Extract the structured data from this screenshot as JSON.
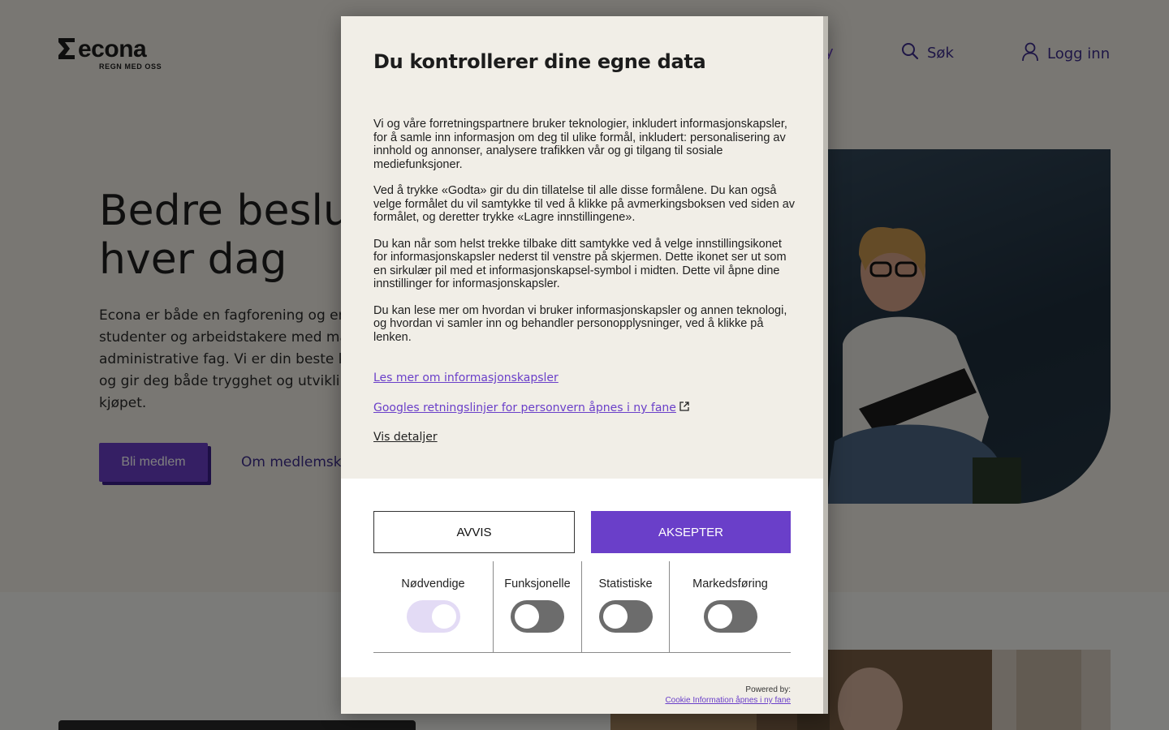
{
  "brand": {
    "name": "econa",
    "tagline": "REGN MED OSS"
  },
  "nav": {
    "partial_item": "y",
    "search_label": "Søk",
    "login_label": "Logg inn"
  },
  "hero": {
    "title_line1": "Bedre beslutninger",
    "title_line2": "hver dag",
    "text_lines": [
      "Econa er både en fagforening og en fagorganisasjon for",
      "studenter og arbeidstakere med mastergrad i økonomiske og",
      "administrative fag. Vi er din beste kollega gjennom karrieren,",
      "og gir deg både trygghet og utvikling – og fordeler på",
      "kjøpet."
    ],
    "primary_button": "Bli medlem",
    "secondary_link": "Om medlemskap"
  },
  "cookie_dialog": {
    "title": "Du kontrollerer dine egne data",
    "paragraphs": [
      "Vi og våre forretningspartnere bruker teknologier, inkludert informasjonskapsler, for å samle inn informasjon om deg til ulike formål, inkludert: personalisering av innhold og annonser, analysere trafikken vår og gi tilgang til sosiale mediefunksjoner.",
      "Ved å trykke «Godta» gir du din tillatelse til alle disse formålene. Du kan også velge formålet du vil samtykke til ved å klikke på avmerkingsboksen ved siden av formålet, og deretter trykke «Lagre innstillingene».",
      "Du kan når som helst trekke tilbake ditt samtykke ved å velge innstillingsikonet for informasjonskapsler nederst til venstre på skjermen. Dette ikonet ser ut som en sirkulær pil med et informasjonskapsel-symbol i midten. Dette vil åpne dine innstillinger for informasjonskapsler.",
      "Du kan lese mer om hvordan vi bruker informasjonskapsler og annen teknologi, og hvordan vi samler inn og behandler personopplysninger, ved å klikke på lenken."
    ],
    "link_cookies": "Les mer om informasjonskapsler",
    "link_google": "Googles retningslinjer for personvern åpnes i ny fane",
    "link_details": "Vis detaljer",
    "reject_label": "AVVIS",
    "accept_label": "AKSEPTER",
    "toggles": [
      {
        "label": "Nødvendige",
        "state": "on"
      },
      {
        "label": "Funksjonelle",
        "state": "off"
      },
      {
        "label": "Statistiske",
        "state": "off"
      },
      {
        "label": "Markedsføring",
        "state": "off"
      }
    ],
    "powered_by": "Powered by:",
    "powered_link": "Cookie Information åpnes i ny fane"
  },
  "colors": {
    "accent": "#6a3fc9",
    "hero_bg": "#f2efe6",
    "dialog_bg": "#f1eee7",
    "toggle_on": "#e3dbf5",
    "toggle_off": "#6c6c6c"
  },
  "icons": {
    "search": "magnifier",
    "login": "user-outline",
    "external_link": "external-link"
  }
}
